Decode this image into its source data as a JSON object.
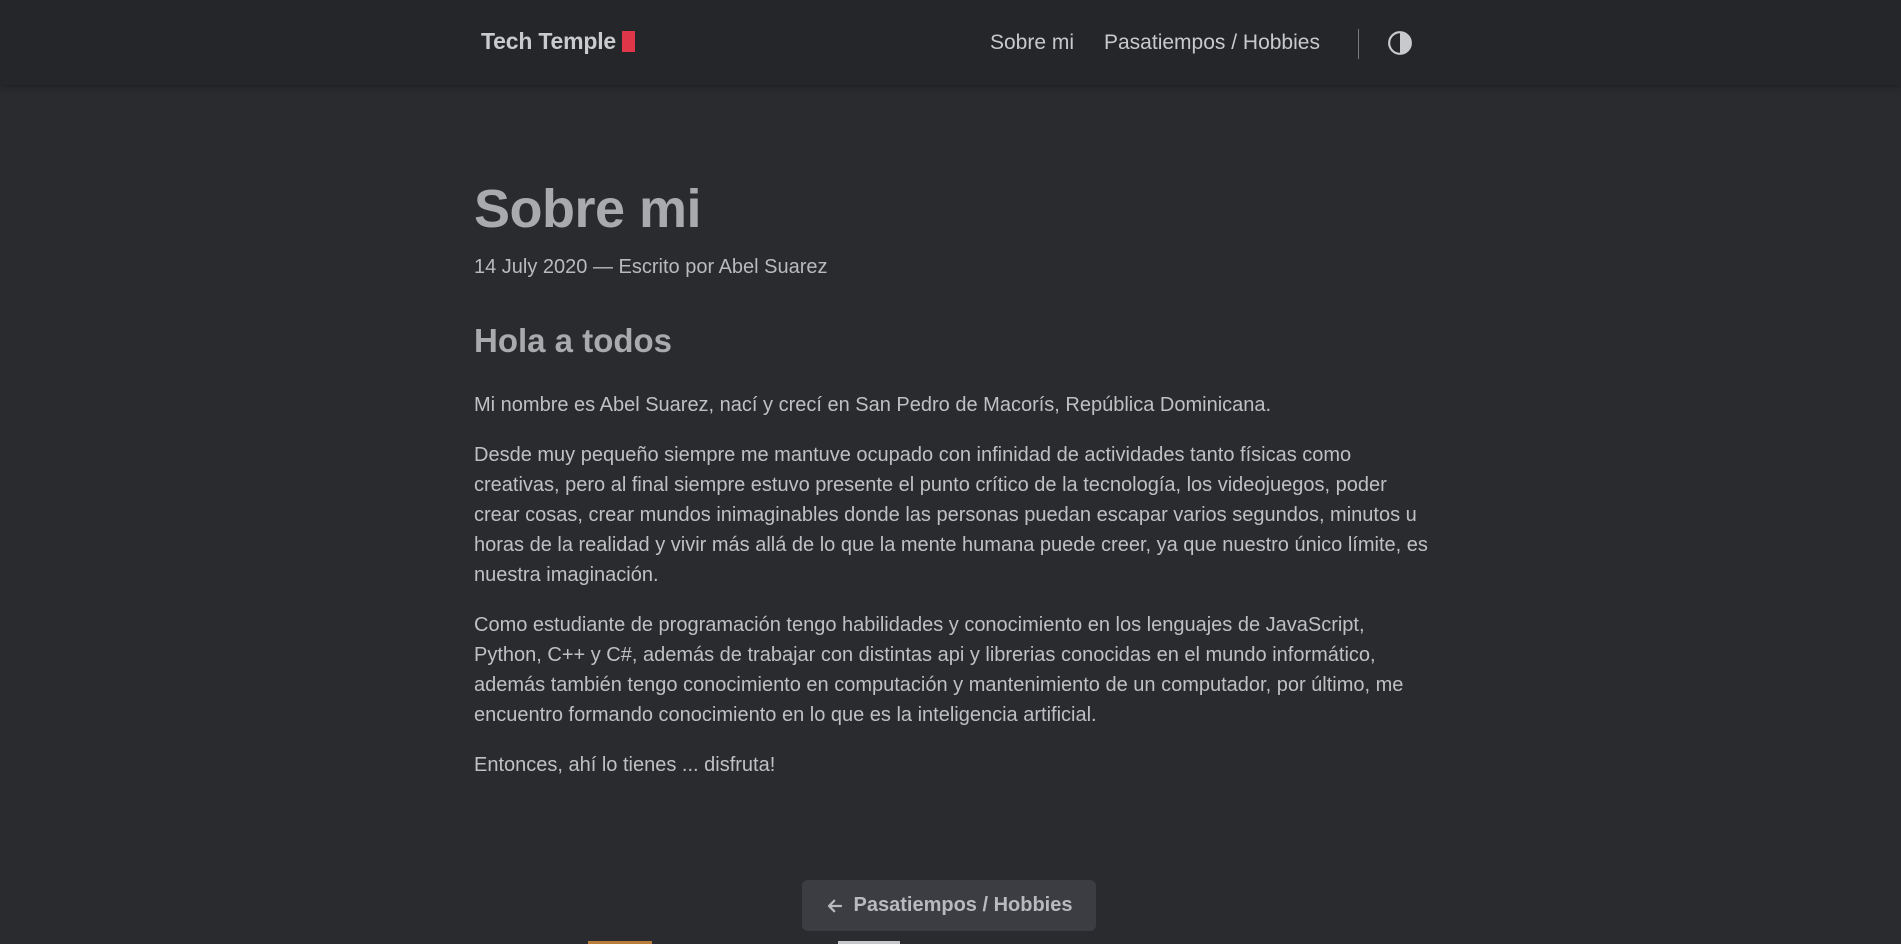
{
  "header": {
    "logo_text": "Tech Temple",
    "cursor_color": "#e0364a",
    "nav": [
      {
        "label": "Sobre mi"
      },
      {
        "label": "Pasatiempos / Hobbies"
      }
    ],
    "theme_toggle_icon": "contrast-icon"
  },
  "article": {
    "title": "Sobre mi",
    "meta": "14 July 2020 — Escrito por Abel Suarez",
    "heading": "Hola a todos",
    "paragraphs": [
      "Mi nombre es Abel Suarez, nací y crecí en San Pedro de Macorís, República Dominicana.",
      "Desde muy pequeño siempre me mantuve ocupado con infinidad de actividades tanto físicas como creativas, pero al final siempre estuvo presente el punto crítico de la tecnología, los videojuegos, poder crear cosas, crear mundos inimaginables donde las personas puedan escapar varios segundos, minutos u horas de la realidad y vivir más allá de lo que la mente humana puede creer, ya que nuestro único límite, es nuestra imaginación.",
      "Como estudiante de programación tengo habilidades y conocimiento en los lenguajes de JavaScript, Python, C++ y C#, además de trabajar con distintas api y librerias conocidas en el mundo informático, además también tengo conocimiento en computación y mantenimiento de un computador, por último, me encuentro formando conocimiento en lo que es la inteligencia artificial.",
      "Entonces, ahí lo tienes ... disfruta!"
    ]
  },
  "pagination": {
    "prev_label": "Pasatiempos / Hobbies",
    "prev_icon": "arrow-left-icon"
  },
  "colors": {
    "background": "#2a2b2f",
    "header_background": "#25262a",
    "accent": "#e0364a"
  }
}
